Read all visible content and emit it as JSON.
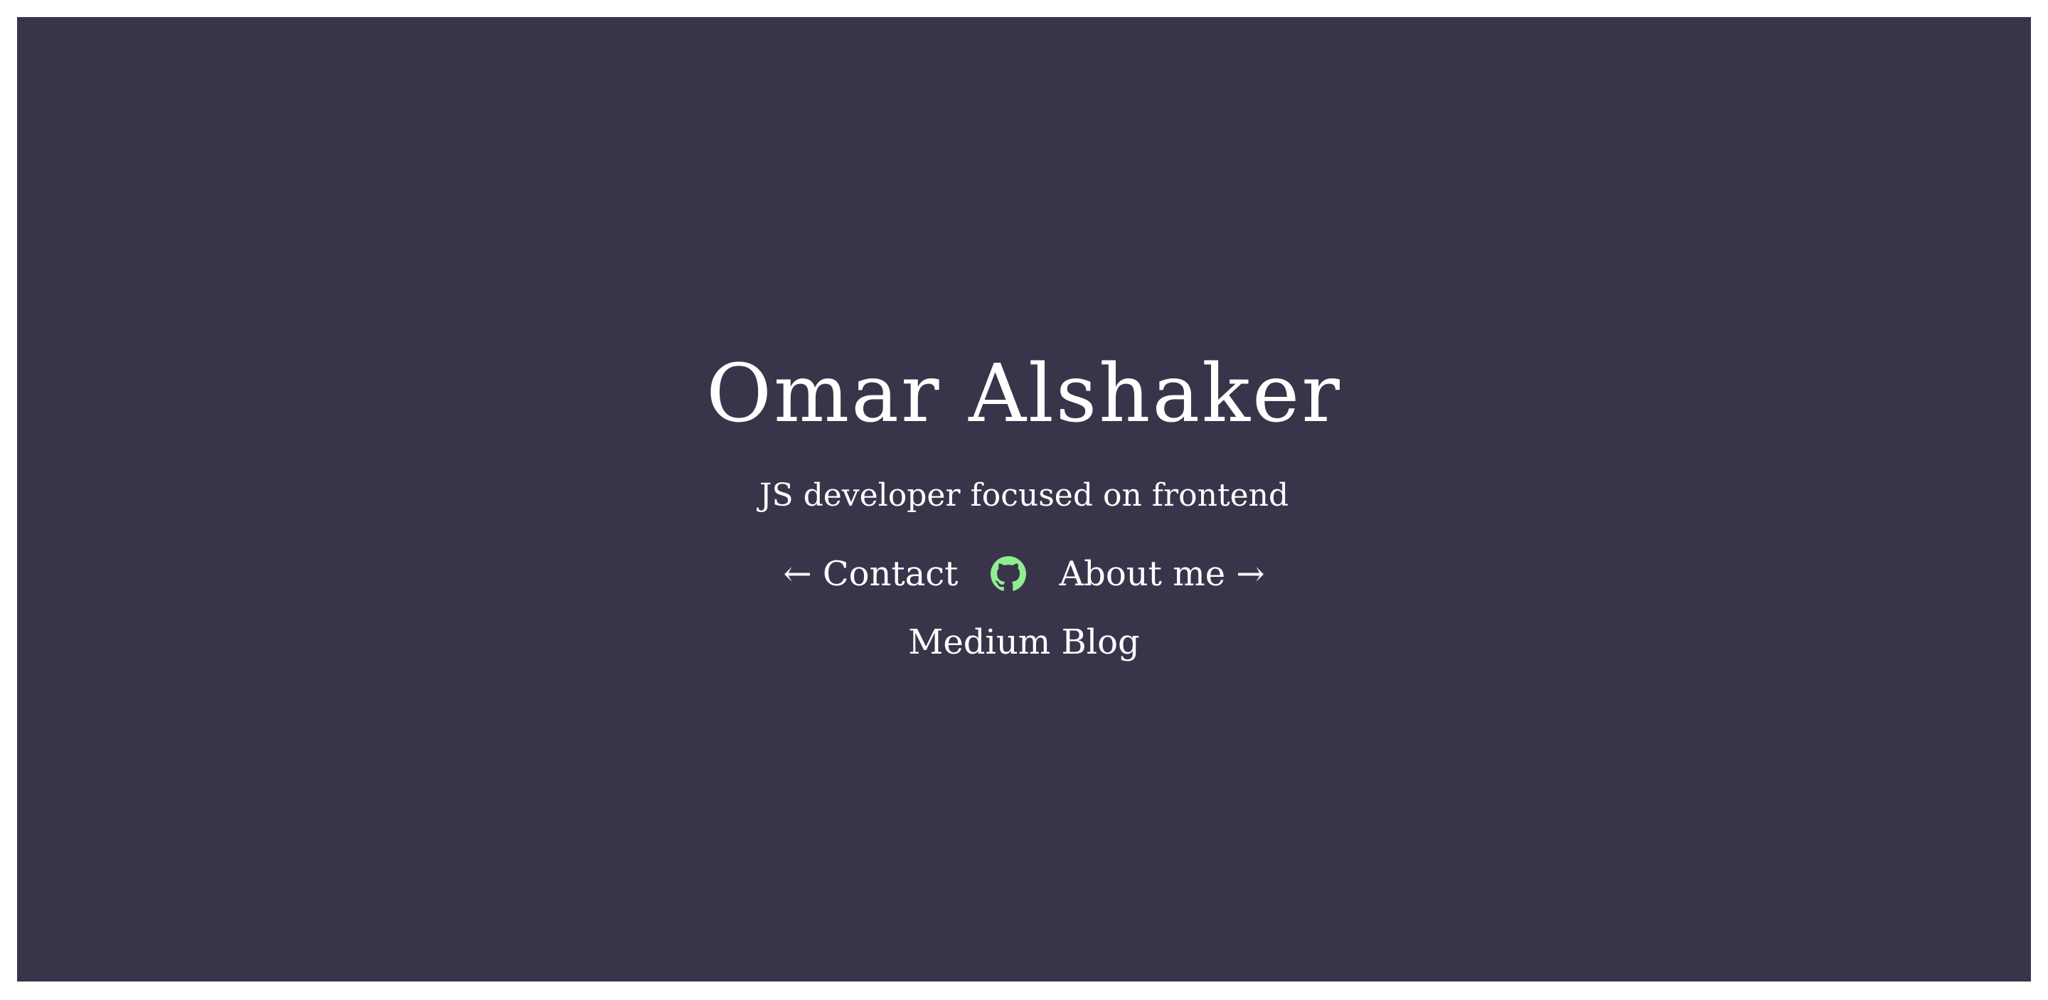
{
  "hero": {
    "name": "Omar Alshaker",
    "tagline": "JS developer focused on frontend"
  },
  "nav": {
    "contact_label": "← Contact",
    "about_label": "About me →",
    "github_icon": "github-icon",
    "github_color": "#90ee90",
    "blog_label": "Medium Blog"
  },
  "colors": {
    "background": "#3a344b",
    "text": "#ffffff",
    "accent": "#90ee90"
  }
}
